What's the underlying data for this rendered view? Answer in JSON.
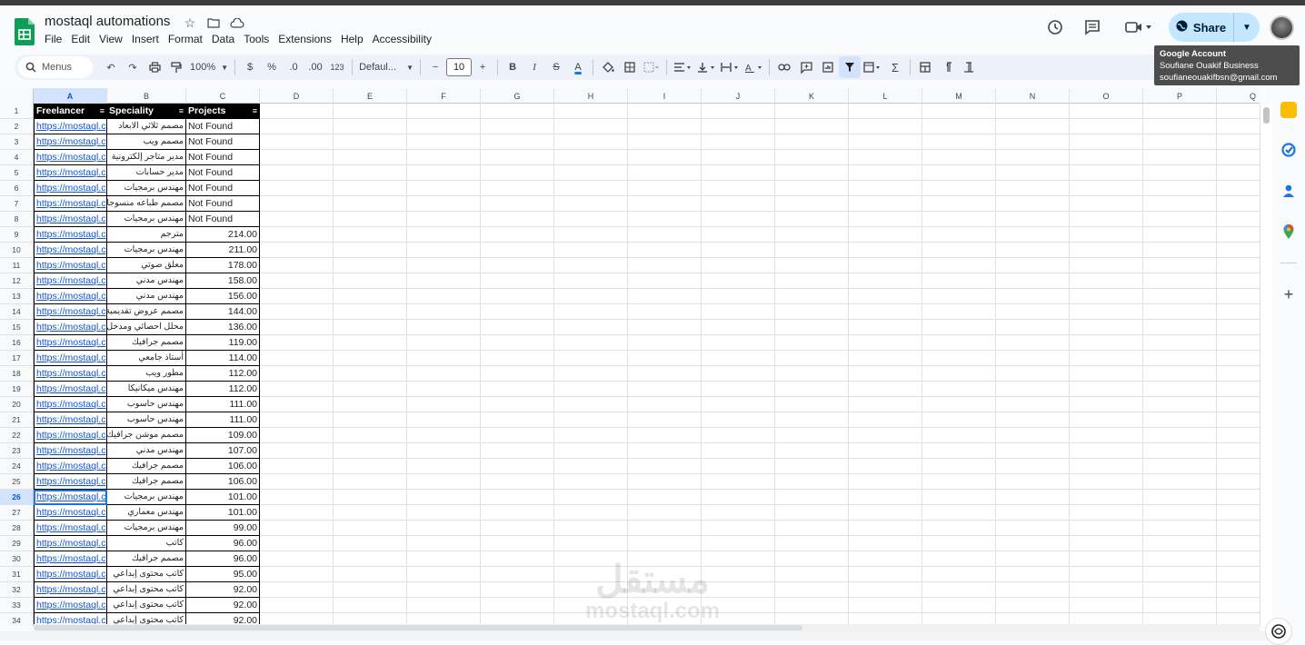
{
  "app": {
    "doc_title": "mostaql automations",
    "menus": [
      "File",
      "Edit",
      "View",
      "Insert",
      "Format",
      "Data",
      "Tools",
      "Extensions",
      "Help",
      "Accessibility"
    ],
    "share_label": "Share"
  },
  "tooltip": {
    "line1": "Google Account",
    "line2": "Soufiane Ouakif Business",
    "line3": "soufianeouakifbsn@gmail.com"
  },
  "toolbar": {
    "search_label": "Menus",
    "zoom": "100%",
    "currency": "$",
    "percent": "%",
    "dec_decrease": ".0",
    "dec_increase": ".00",
    "number_format": "123",
    "font": "Defaul...",
    "font_size": "10",
    "bold": "B",
    "italic": "I",
    "strike": "S",
    "text_color": "A",
    "sum": "Σ"
  },
  "sheet": {
    "columns": [
      "A",
      "B",
      "C",
      "D",
      "E",
      "F",
      "G",
      "H",
      "I",
      "J",
      "K",
      "L",
      "M",
      "N",
      "O",
      "P",
      "Q"
    ],
    "selected_column": "A",
    "selected_row": "26",
    "headers": [
      "Freelancer",
      "Speciality",
      "Projects"
    ],
    "rows": [
      {
        "n": "2",
        "a": "https://mostaql.c",
        "b": "مصمم ثلاثي الابعاد",
        "c": "Not Found"
      },
      {
        "n": "3",
        "a": "https://mostaql.c",
        "b": "مصمم ويب",
        "c": "Not Found"
      },
      {
        "n": "4",
        "a": "https://mostaql.c",
        "b": "مدير متاجر إلكترونية",
        "c": "Not Found"
      },
      {
        "n": "5",
        "a": "https://mostaql.c",
        "b": "مدير حسابات",
        "c": "Not Found"
      },
      {
        "n": "6",
        "a": "https://mostaql.c",
        "b": "مهندس برمجيات",
        "c": "Not Found"
      },
      {
        "n": "7",
        "a": "https://mostaql.c",
        "b": "مصمم طباعه منسوجات",
        "c": "Not Found"
      },
      {
        "n": "8",
        "a": "https://mostaql.c",
        "b": "مهندس برمجيات",
        "c": "Not Found"
      },
      {
        "n": "9",
        "a": "https://mostaql.c",
        "b": "مترجم",
        "c": "214.00"
      },
      {
        "n": "10",
        "a": "https://mostaql.c",
        "b": "مهندس برمجيات",
        "c": "211.00"
      },
      {
        "n": "11",
        "a": "https://mostaql.c",
        "b": "معلق صوتي",
        "c": "178.00"
      },
      {
        "n": "12",
        "a": "https://mostaql.c",
        "b": "مهندس مدني",
        "c": "158.00"
      },
      {
        "n": "13",
        "a": "https://mostaql.c",
        "b": "مهندس مدني",
        "c": "156.00"
      },
      {
        "n": "14",
        "a": "https://mostaql.c",
        "b": "مصمم عروض تقديمية",
        "c": "144.00"
      },
      {
        "n": "15",
        "a": "https://mostaql.c",
        "b": "محلل احصائي ومدخل بيانات",
        "c": "136.00"
      },
      {
        "n": "16",
        "a": "https://mostaql.c",
        "b": "مصمم جرافيك",
        "c": "119.00"
      },
      {
        "n": "17",
        "a": "https://mostaql.c",
        "b": "أستاذ جامعي",
        "c": "114.00"
      },
      {
        "n": "18",
        "a": "https://mostaql.c",
        "b": "مطور ويب",
        "c": "112.00"
      },
      {
        "n": "19",
        "a": "https://mostaql.c",
        "b": "مهندس ميكانيكا",
        "c": "112.00"
      },
      {
        "n": "20",
        "a": "https://mostaql.c",
        "b": "مهندس حاسوب",
        "c": "111.00"
      },
      {
        "n": "21",
        "a": "https://mostaql.c",
        "b": "مهندس حاسوب",
        "c": "111.00"
      },
      {
        "n": "22",
        "a": "https://mostaql.c",
        "b": "مصمم موشن جرافيك",
        "c": "109.00"
      },
      {
        "n": "23",
        "a": "https://mostaql.c",
        "b": "مهندس مدني",
        "c": "107.00"
      },
      {
        "n": "24",
        "a": "https://mostaql.c",
        "b": "مصمم جرافيك",
        "c": "106.00"
      },
      {
        "n": "25",
        "a": "https://mostaql.c",
        "b": "مصمم جرافيك",
        "c": "106.00"
      },
      {
        "n": "26",
        "a": "https://mostaql.c",
        "b": "مهندس برمجيات",
        "c": "101.00"
      },
      {
        "n": "27",
        "a": "https://mostaql.c",
        "b": "مهندس معماري",
        "c": "101.00"
      },
      {
        "n": "28",
        "a": "https://mostaql.c",
        "b": "مهندس برمجيات",
        "c": "99.00"
      },
      {
        "n": "29",
        "a": "https://mostaql.c",
        "b": "كاتب",
        "c": "96.00"
      },
      {
        "n": "30",
        "a": "https://mostaql.c",
        "b": "مصمم جرافيك",
        "c": "96.00"
      },
      {
        "n": "31",
        "a": "https://mostaql.c",
        "b": "كاتب محتوى إبداعي",
        "c": "95.00"
      },
      {
        "n": "32",
        "a": "https://mostaql.c",
        "b": "كاتب محتوى إبداعي",
        "c": "92.00"
      },
      {
        "n": "33",
        "a": "https://mostaql.c",
        "b": "كاتب محتوى إبداعي",
        "c": "92.00"
      },
      {
        "n": "34",
        "a": "https://mostaql.c",
        "b": "كاتب محتوى إبداعي",
        "c": "92.00"
      }
    ]
  },
  "watermark": {
    "arabic": "مستقل",
    "latin": "mostaql.com"
  },
  "colors": {
    "share_bg": "#c2e7ff",
    "selection": "#1a73e8",
    "link": "#1155cc",
    "header_bg": "#000000"
  }
}
